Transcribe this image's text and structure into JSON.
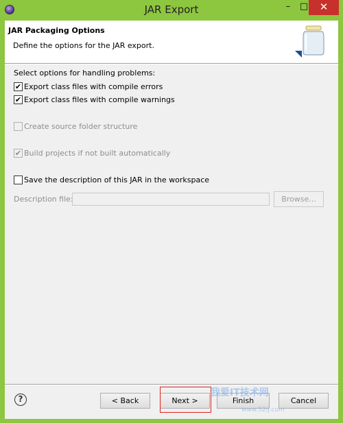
{
  "window": {
    "title": "JAR Export",
    "minimize": "–",
    "maximize": "□",
    "close": "✕"
  },
  "header": {
    "title": "JAR Packaging Options",
    "description": "Define the options for the JAR export."
  },
  "options": {
    "problems_label": "Select options for handling problems:",
    "compile_errors": {
      "label": "Export class files with compile errors",
      "checked": true
    },
    "compile_warnings": {
      "label": "Export class files with compile warnings",
      "checked": true
    },
    "source_folder": {
      "label": "Create source folder structure",
      "checked": false,
      "enabled": false
    },
    "build_projects": {
      "label": "Build projects if not built automatically",
      "checked": true,
      "enabled": false
    },
    "save_description": {
      "label": "Save the description of this JAR in the workspace",
      "checked": false
    }
  },
  "description_file": {
    "label": "Description file:",
    "value": "",
    "browse": "Browse..."
  },
  "footer": {
    "help": "?",
    "back": "< Back",
    "next": "Next >",
    "finish": "Finish",
    "cancel": "Cancel"
  },
  "watermark": {
    "text": "我爱IT技术网",
    "url": "www.52ij.com"
  },
  "colors": {
    "frame": "#8dc63f",
    "close": "#c7302b",
    "highlight": "#e02020"
  }
}
